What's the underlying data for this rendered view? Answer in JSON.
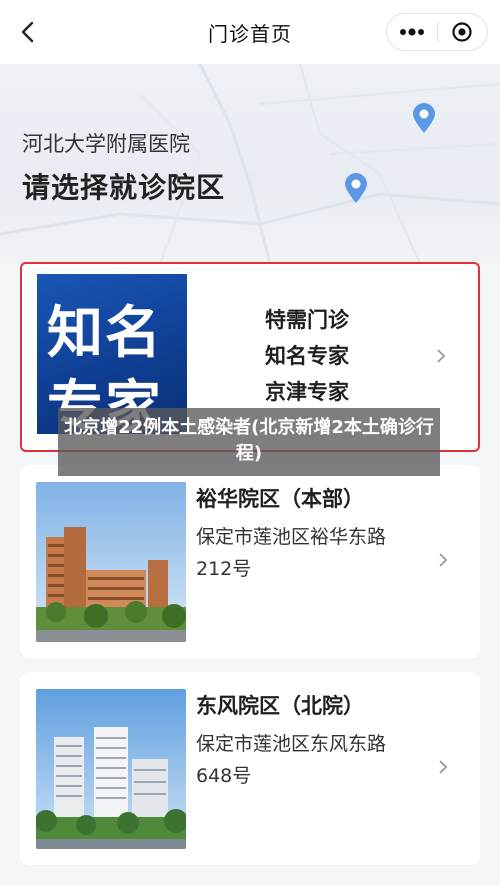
{
  "navbar": {
    "back_icon": "chevron-left-icon",
    "title": "门诊首页",
    "more_icon": "more-dots-icon",
    "close_icon": "target-close-icon"
  },
  "banner": {
    "hospital_name": "河北大学附属医院",
    "title": "请选择就诊院区"
  },
  "special_card": {
    "image_text": [
      "知名",
      "专家"
    ],
    "services": [
      "特需门诊",
      "知名专家",
      "京津专家"
    ]
  },
  "campuses": [
    {
      "name": "裕华院区（本部）",
      "address": "保定市莲池区裕华东路212号"
    },
    {
      "name": "东风院区（北院）",
      "address": "保定市莲池区东风东路648号"
    }
  ],
  "caption": "北京增22例本土感染者(北京新增2本土确诊行程)",
  "colors": {
    "highlight_border": "#e0313a",
    "accent_blue": "#1a57b6",
    "pin_blue": "#4a8fe3"
  }
}
